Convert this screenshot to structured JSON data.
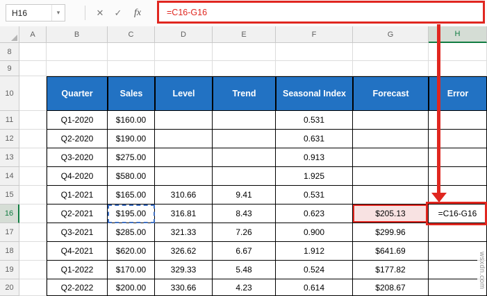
{
  "formula_bar": {
    "name_box_value": "H16",
    "dropdown_icon": "▾",
    "cancel_icon": "✕",
    "enter_icon": "✓",
    "fx_icon": "fx",
    "formula": "=C16-G16"
  },
  "sheet": {
    "column_headers": [
      "A",
      "B",
      "C",
      "D",
      "E",
      "F",
      "G",
      "H"
    ],
    "row_headers": [
      "8",
      "9",
      "10",
      "11",
      "12",
      "13",
      "14",
      "15",
      "16",
      "17",
      "18",
      "19",
      "20"
    ],
    "active_column": "H",
    "active_row": "16"
  },
  "table": {
    "headers": [
      "Quarter",
      "Sales",
      "Level",
      "Trend",
      "Seasonal Index",
      "Forecast",
      "Error"
    ],
    "rows": [
      [
        "Q1-2020",
        "$160.00",
        "",
        "",
        "0.531",
        "",
        ""
      ],
      [
        "Q2-2020",
        "$190.00",
        "",
        "",
        "0.631",
        "",
        ""
      ],
      [
        "Q3-2020",
        "$275.00",
        "",
        "",
        "0.913",
        "",
        ""
      ],
      [
        "Q4-2020",
        "$580.00",
        "",
        "",
        "1.925",
        "",
        ""
      ],
      [
        "Q1-2021",
        "$165.00",
        "310.66",
        "9.41",
        "0.531",
        "",
        ""
      ],
      [
        "Q2-2021",
        "$195.00",
        "316.81",
        "8.43",
        "0.623",
        "$205.13",
        "=C16-G16"
      ],
      [
        "Q3-2021",
        "$285.00",
        "321.33",
        "7.26",
        "0.900",
        "$299.96",
        ""
      ],
      [
        "Q4-2021",
        "$620.00",
        "326.62",
        "6.67",
        "1.912",
        "$641.69",
        ""
      ],
      [
        "Q1-2022",
        "$170.00",
        "329.33",
        "5.48",
        "0.524",
        "$177.82",
        ""
      ],
      [
        "Q2-2022",
        "$200.00",
        "330.66",
        "4.23",
        "0.614",
        "$208.67",
        ""
      ]
    ]
  },
  "watermark": "wsxdn.com",
  "colors": {
    "header_blue": "#2272C3",
    "annotation_red": "#E0261F",
    "reference_blue": "#3E6FC1",
    "reference_red_fill": "#F8E2E2",
    "active_green": "#107C41"
  }
}
